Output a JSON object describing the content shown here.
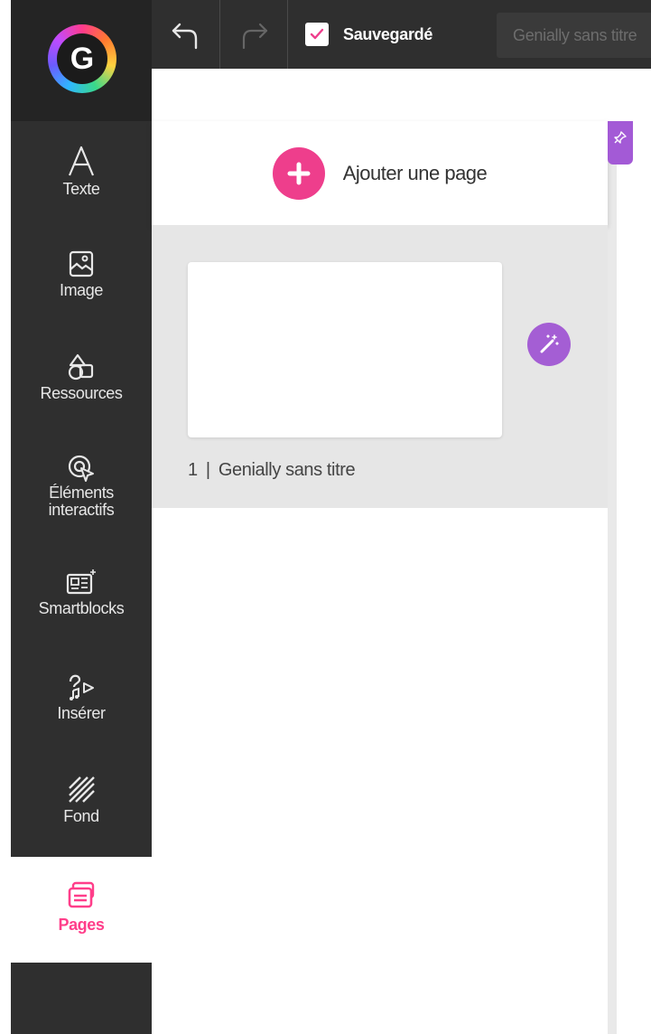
{
  "app": {
    "logo_letter": "G"
  },
  "toolbar": {
    "undo_icon": "undo-icon",
    "redo_icon": "redo-icon",
    "saved_label": "Sauvegardé",
    "title_placeholder": "Genially sans titre"
  },
  "sidebar": {
    "items": [
      {
        "label": "Texte",
        "icon": "text-icon"
      },
      {
        "label": "Image",
        "icon": "image-icon"
      },
      {
        "label": "Ressources",
        "icon": "resources-icon"
      },
      {
        "label": "Éléments interactifs",
        "label_line1": "Éléments",
        "label_line2": "interactifs",
        "icon": "interactive-icon"
      },
      {
        "label": "Smartblocks",
        "icon": "smartblocks-icon"
      },
      {
        "label": "Insérer",
        "icon": "insert-icon"
      },
      {
        "label": "Fond",
        "icon": "background-icon"
      },
      {
        "label": "Pages",
        "icon": "pages-icon",
        "active": true
      }
    ]
  },
  "pages_panel": {
    "add_page_label": "Ajouter une page",
    "pages": [
      {
        "number": "1",
        "separator": "|",
        "title": "Genially sans titre"
      }
    ]
  },
  "colors": {
    "accent_pink": "#ee3e8c",
    "accent_purple": "#a45ed4",
    "rail_bg": "#2f2f2f"
  }
}
